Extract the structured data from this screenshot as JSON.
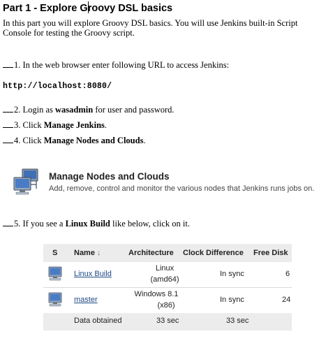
{
  "doc": {
    "title_pre": "Part 1 - Explore G",
    "title_post": "roovy DSL basics",
    "intro": "In this part you will explore Groovy DSL basics. You will use Jenkins built-in Script Console for testing the Groovy script.",
    "step1": "1. In the web browser enter following URL to access Jenkins:",
    "url": "http://localhost:8080/",
    "step2_pre": "2. Login as ",
    "step2_bold": "wasadmin",
    "step2_post": " for user and password.",
    "step3_pre": "3. Click ",
    "step3_bold": "Manage Jenkins",
    "step3_post": ".",
    "step4_pre": "4. Click ",
    "step4_bold": "Manage Nodes and Clouds",
    "step4_post": ".",
    "step5_pre": "5. If you see a ",
    "step5_bold": "Linux Build",
    "step5_post": " like below, click on it."
  },
  "manage_card": {
    "title": "Manage Nodes and Clouds",
    "desc": "Add, remove, control and monitor the various nodes that Jenkins runs jobs on.",
    "icon": "computer-network-icon"
  },
  "nodes_table": {
    "headers": {
      "s": "S",
      "name": "Name",
      "sort_arrow": "↓",
      "arch": "Architecture",
      "clock": "Clock Difference",
      "free_disk": "Free Disk"
    },
    "rows": [
      {
        "name": "Linux Build",
        "arch_l1": "Linux",
        "arch_l2": "(amd64)",
        "clock": "In sync",
        "free_disk": "6"
      },
      {
        "name": "master",
        "arch_l1": "Windows 8.1",
        "arch_l2": "(x86)",
        "clock": "In sync",
        "free_disk": "24"
      }
    ],
    "footer": {
      "label": "Data obtained",
      "arch": "33 sec",
      "clock": "33 sec"
    }
  }
}
